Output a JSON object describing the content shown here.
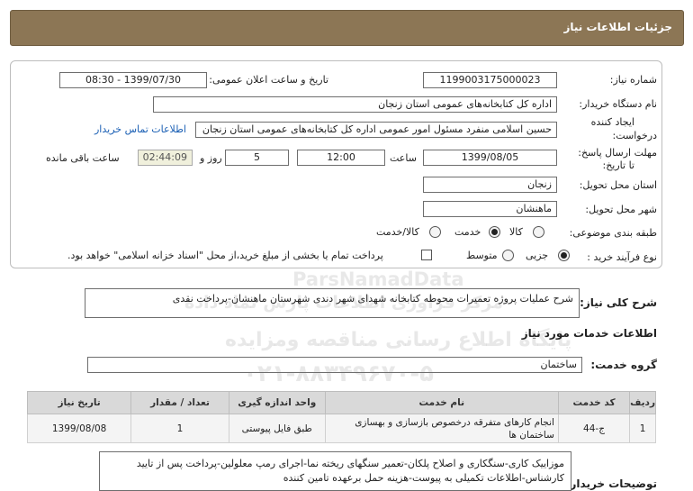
{
  "header": {
    "title": "جزئیات اطلاعات نیاز"
  },
  "form": {
    "need_number_label": "شماره نیاز:",
    "need_number": "1199003175000023",
    "announce_label": "تاریخ و ساعت اعلان عمومی:",
    "announce_value": "1399/07/30 - 08:30",
    "buyer_label": "نام دستگاه خریدار:",
    "buyer_value": "اداره کل کتابخانه‌های عمومی استان زنجان",
    "creator_label_1": "ایجاد کننده",
    "creator_label_2": "درخواست:",
    "creator_value": "حسین اسلامی منفرد مسئول امور عمومی اداره کل کتابخانه‌های عمومی استان زنجان",
    "contact_link": "اطلاعات تماس خریدار",
    "deadline_label_1": "مهلت ارسال پاسخ:",
    "deadline_label_2": "تا تاریخ:",
    "deadline_date": "1399/08/05",
    "hour_label": "ساعت",
    "deadline_hour": "12:00",
    "days_value": "5",
    "days_label": "روز و",
    "timer_value": "02:44:09",
    "remaining_label": "ساعت باقی مانده",
    "province_label": "استان محل تحویل:",
    "province_value": "زنجان",
    "city_label": "شهر محل تحویل:",
    "city_value": "ماهنشان",
    "category_label": "طبقه بندی موضوعی:",
    "category_options": [
      "کالا",
      "خدمت",
      "کالا/خدمت"
    ],
    "category_selected": "خدمت",
    "process_label": "نوع فرآیند خرید :",
    "process_options": [
      "جزیی",
      "متوسط"
    ],
    "process_selected": "جزیی",
    "payment_note": "پرداخت تمام یا بخشی از مبلغ خرید،از محل \"اسناد خزانه اسلامی\" خواهد بود."
  },
  "summary": {
    "label": "شرح کلی نیاز:",
    "value": "شرح عملیات پروژه تعمیرات محوطه کتابخانه شهدای شهر دندی شهرستان ماهنشان-پرداخت نقدی"
  },
  "services_section_title": "اطلاعات خدمات مورد نیاز",
  "service_group": {
    "label": "گروه خدمت:",
    "value": "ساختمان"
  },
  "table": {
    "headers": [
      "ردیف",
      "کد خدمت",
      "نام خدمت",
      "واحد اندازه گیری",
      "تعداد / مقدار",
      "تاریخ نیاز"
    ],
    "rows": [
      [
        "1",
        "ج-44",
        "انجام کارهای متفرقه درخصوص بازسازی و بهسازی ساختمان ها",
        "طبق فایل پیوستی",
        "1",
        "1399/08/08"
      ]
    ]
  },
  "buyer_notes": {
    "label": "توضیحات خریدار:",
    "value": "موزاییک کاری-سنگکاری و اصلاح پلکان-تعمیر سنگهای ریخته نما-اجرای رمپ معلولین-پرداخت پس از تایید کارشناس-اطلاعات تکمیلی به پیوست-هزینه حمل برعهده تامین کننده"
  },
  "watermark": {
    "brand": "ParsNamadData",
    "line1": "مرکز فراوری اطلاعات پارس نماد داده",
    "line2": "پایگاه اطلاع رسانی مناقصه ومزایده",
    "phone": "۰۲۱-۸۸۳۴۹۶۷۰-۵"
  }
}
